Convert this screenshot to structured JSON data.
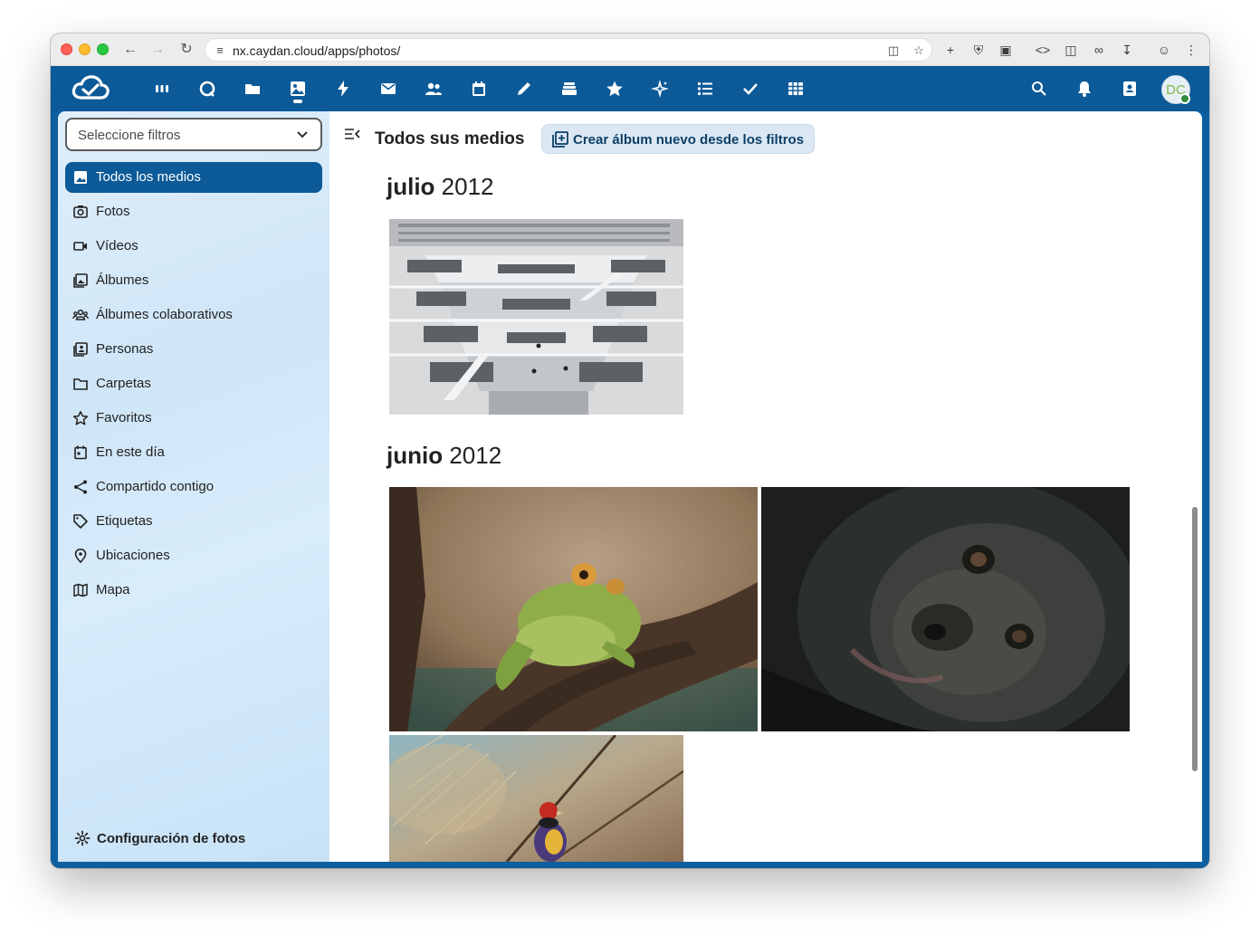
{
  "browser": {
    "url": "nx.caydan.cloud/apps/photos/"
  },
  "header": {
    "avatar_initials": "DC",
    "apps": [
      "dashboard-icon",
      "talk-icon",
      "files-icon",
      "photos-icon",
      "activity-icon",
      "mail-icon",
      "contacts-icon",
      "calendar-icon",
      "notes-icon",
      "deck-icon",
      "favorites-icon",
      "ai-assistant-icon",
      "tasks-list-icon",
      "tasks-icon",
      "tables-icon"
    ],
    "brand_color": "#0c5a98"
  },
  "sidebar": {
    "filter_placeholder": "Seleccione filtros",
    "items": [
      {
        "label": "Todos los medios",
        "icon": "image-icon",
        "active": true
      },
      {
        "label": "Fotos",
        "icon": "camera-icon",
        "active": false
      },
      {
        "label": "Vídeos",
        "icon": "video-icon",
        "active": false
      },
      {
        "label": "Álbumes",
        "icon": "album-icon",
        "active": false
      },
      {
        "label": "Álbumes colaborativos",
        "icon": "shared-album-icon",
        "active": false
      },
      {
        "label": "Personas",
        "icon": "people-icon",
        "active": false
      },
      {
        "label": "Carpetas",
        "icon": "folder-icon",
        "active": false
      },
      {
        "label": "Favoritos",
        "icon": "star-icon",
        "active": false
      },
      {
        "label": "En este día",
        "icon": "calendar-day-icon",
        "active": false
      },
      {
        "label": "Compartido contigo",
        "icon": "share-icon",
        "active": false
      },
      {
        "label": "Etiquetas",
        "icon": "tag-icon",
        "active": false
      },
      {
        "label": "Ubicaciones",
        "icon": "location-icon",
        "active": false
      },
      {
        "label": "Mapa",
        "icon": "map-icon",
        "active": false
      }
    ],
    "settings_label": "Configuración de fotos"
  },
  "main": {
    "title": "Todos sus medios",
    "create_album_label": "Crear álbum nuevo desde los filtros",
    "sections": [
      {
        "month": "julio",
        "year": "2012",
        "photos": [
          "library-photo"
        ]
      },
      {
        "month": "junio",
        "year": "2012",
        "photos": [
          "frog-photo",
          "gorilla-photo",
          "bird-photo"
        ]
      }
    ]
  }
}
